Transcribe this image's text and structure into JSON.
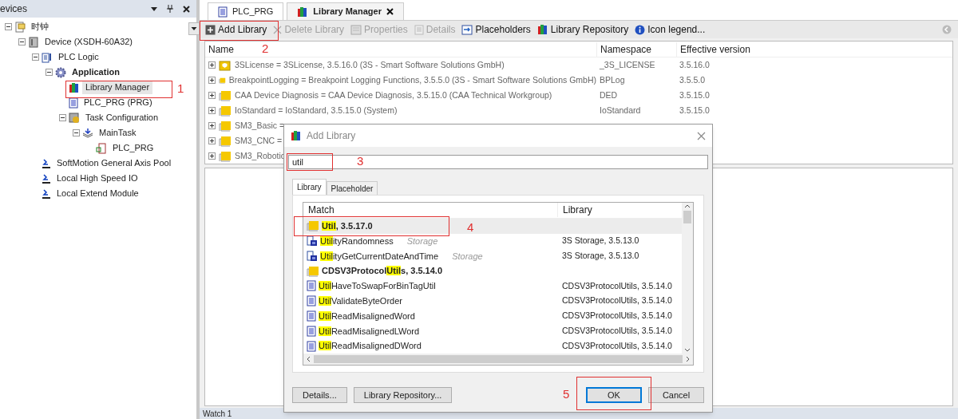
{
  "devices_panel": {
    "title": "evices",
    "tree": [
      {
        "label": "时钟",
        "kind": "project",
        "expanded": true,
        "selected": false,
        "bold": false,
        "children": [
          {
            "label": "Device (XSDH-60A32)",
            "kind": "device",
            "expanded": true,
            "selected": false,
            "bold": false,
            "children": [
              {
                "label": "PLC Logic",
                "kind": "plc",
                "expanded": true,
                "selected": false,
                "bold": false,
                "children": [
                  {
                    "label": "Application",
                    "kind": "gear",
                    "expanded": true,
                    "selected": false,
                    "bold": true,
                    "children": [
                      {
                        "label": "Library Manager",
                        "kind": "books",
                        "selected": true,
                        "bold": false
                      },
                      {
                        "label": "PLC_PRG (PRG)",
                        "kind": "doc",
                        "selected": false,
                        "bold": false
                      },
                      {
                        "label": "Task Configuration",
                        "kind": "task",
                        "expanded": true,
                        "selected": false,
                        "bold": false,
                        "children": [
                          {
                            "label": "MainTask",
                            "kind": "stack",
                            "expanded": true,
                            "selected": false,
                            "bold": false,
                            "children": [
                              {
                                "label": "PLC_PRG",
                                "kind": "call",
                                "selected": false,
                                "bold": false
                              }
                            ]
                          }
                        ]
                      }
                    ]
                  }
                ]
              },
              {
                "label": "SoftMotion General Axis Pool",
                "kind": "axis",
                "selected": false,
                "bold": false
              },
              {
                "label": "Local High Speed IO",
                "kind": "axis",
                "selected": false,
                "bold": false
              },
              {
                "label": "Local Extend Module",
                "kind": "axis",
                "selected": false,
                "bold": false
              }
            ]
          }
        ]
      }
    ]
  },
  "editor_tabs": [
    {
      "label": "PLC_PRG",
      "kind": "doc",
      "selected": false,
      "closable": false
    },
    {
      "label": "Library Manager",
      "kind": "books",
      "selected": true,
      "closable": true
    }
  ],
  "toolbar": [
    {
      "label": "Add Library",
      "kind": "plus",
      "disabled": false
    },
    {
      "label": "Delete Library",
      "kind": "x",
      "disabled": true
    },
    {
      "label": "Properties",
      "kind": "props",
      "disabled": true
    },
    {
      "label": "Details",
      "kind": "details",
      "disabled": true
    },
    {
      "label": "Placeholders",
      "kind": "ph",
      "disabled": false
    },
    {
      "label": "Library Repository",
      "kind": "books",
      "disabled": false
    },
    {
      "label": "Icon legend...",
      "kind": "info",
      "disabled": false
    }
  ],
  "library_table": {
    "columns": [
      "Name",
      "Namespace",
      "Effective version"
    ],
    "rows": [
      {
        "name": "3SLicense = 3SLicense, 3.5.16.0 (3S - Smart Software Solutions GmbH)",
        "namespace": "_3S_LICENSE",
        "version": "3.5.16.0",
        "kind": "shield"
      },
      {
        "name": "BreakpointLogging = Breakpoint Logging Functions, 3.5.5.0 (3S - Smart Software Solutions GmbH)",
        "namespace": "BPLog",
        "version": "3.5.5.0",
        "kind": "folder"
      },
      {
        "name": "CAA Device Diagnosis = CAA Device Diagnosis, 3.5.15.0 (CAA Technical Workgroup)",
        "namespace": "DED",
        "version": "3.5.15.0",
        "kind": "folder"
      },
      {
        "name": "IoStandard = IoStandard, 3.5.15.0 (System)",
        "namespace": "IoStandard",
        "version": "3.5.15.0",
        "kind": "folder"
      },
      {
        "name": "SM3_Basic =",
        "kind": "folder"
      },
      {
        "name": "SM3_CNC =",
        "kind": "folder"
      },
      {
        "name": "SM3_Robotic",
        "kind": "folder"
      }
    ]
  },
  "bottom_panel": {
    "title": "Watch 1"
  },
  "dialog": {
    "title": "Add Library",
    "search": {
      "value": "util"
    },
    "tabs": [
      {
        "label": "Library",
        "selected": true
      },
      {
        "label": "Placeholder",
        "selected": false
      }
    ],
    "columns": [
      "Match",
      "Library"
    ],
    "rows": [
      {
        "kind": "library",
        "parts": [
          {
            "text": "Util",
            "highlight": true
          },
          {
            "text": ", 3.5.17.0",
            "highlight": false
          }
        ],
        "selected": true
      },
      {
        "kind": "function",
        "parts": [
          {
            "text": "Util",
            "highlight": true
          },
          {
            "text": "ityRandomness",
            "highlight": false
          }
        ],
        "tag": "Storage",
        "library": "3S Storage, 3.5.13.0",
        "selected": false
      },
      {
        "kind": "function",
        "parts": [
          {
            "text": "Util",
            "highlight": true
          },
          {
            "text": "ityGetCurrentDateAndTime",
            "highlight": false
          }
        ],
        "tag": "Storage",
        "library": "3S Storage, 3.5.13.0",
        "selected": false
      },
      {
        "kind": "library",
        "parts": [
          {
            "text": "CDSV3Protocol",
            "highlight": false
          },
          {
            "text": "Util",
            "highlight": true
          },
          {
            "text": "s, 3.5.14.0",
            "highlight": false
          }
        ],
        "selected": false
      },
      {
        "kind": "pou",
        "parts": [
          {
            "text": "Util",
            "highlight": true
          },
          {
            "text": "HaveToSwapForBinTagUtil",
            "highlight": false
          }
        ],
        "library": "CDSV3ProtocolUtils, 3.5.14.0",
        "selected": false
      },
      {
        "kind": "pou",
        "parts": [
          {
            "text": "Util",
            "highlight": true
          },
          {
            "text": "ValidateByteOrder",
            "highlight": false
          }
        ],
        "library": "CDSV3ProtocolUtils, 3.5.14.0",
        "selected": false
      },
      {
        "kind": "pou",
        "parts": [
          {
            "text": "Util",
            "highlight": true
          },
          {
            "text": "ReadMisalignedWord",
            "highlight": false
          }
        ],
        "library": "CDSV3ProtocolUtils, 3.5.14.0",
        "selected": false
      },
      {
        "kind": "pou",
        "parts": [
          {
            "text": "Util",
            "highlight": true
          },
          {
            "text": "ReadMisalignedLWord",
            "highlight": false
          }
        ],
        "library": "CDSV3ProtocolUtils, 3.5.14.0",
        "selected": false
      },
      {
        "kind": "pou",
        "parts": [
          {
            "text": "Util",
            "highlight": true
          },
          {
            "text": "ReadMisalignedDWord",
            "highlight": false
          }
        ],
        "library": "CDSV3ProtocolUtils, 3.5.14.0",
        "selected": false
      }
    ],
    "buttons": [
      {
        "label": "Details...",
        "default": false
      },
      {
        "label": "Library Repository...",
        "default": false
      },
      {
        "label": "OK",
        "default": true
      },
      {
        "label": "Cancel",
        "default": false
      }
    ]
  },
  "annotations": [
    "1",
    "2",
    "3",
    "4",
    "5"
  ]
}
